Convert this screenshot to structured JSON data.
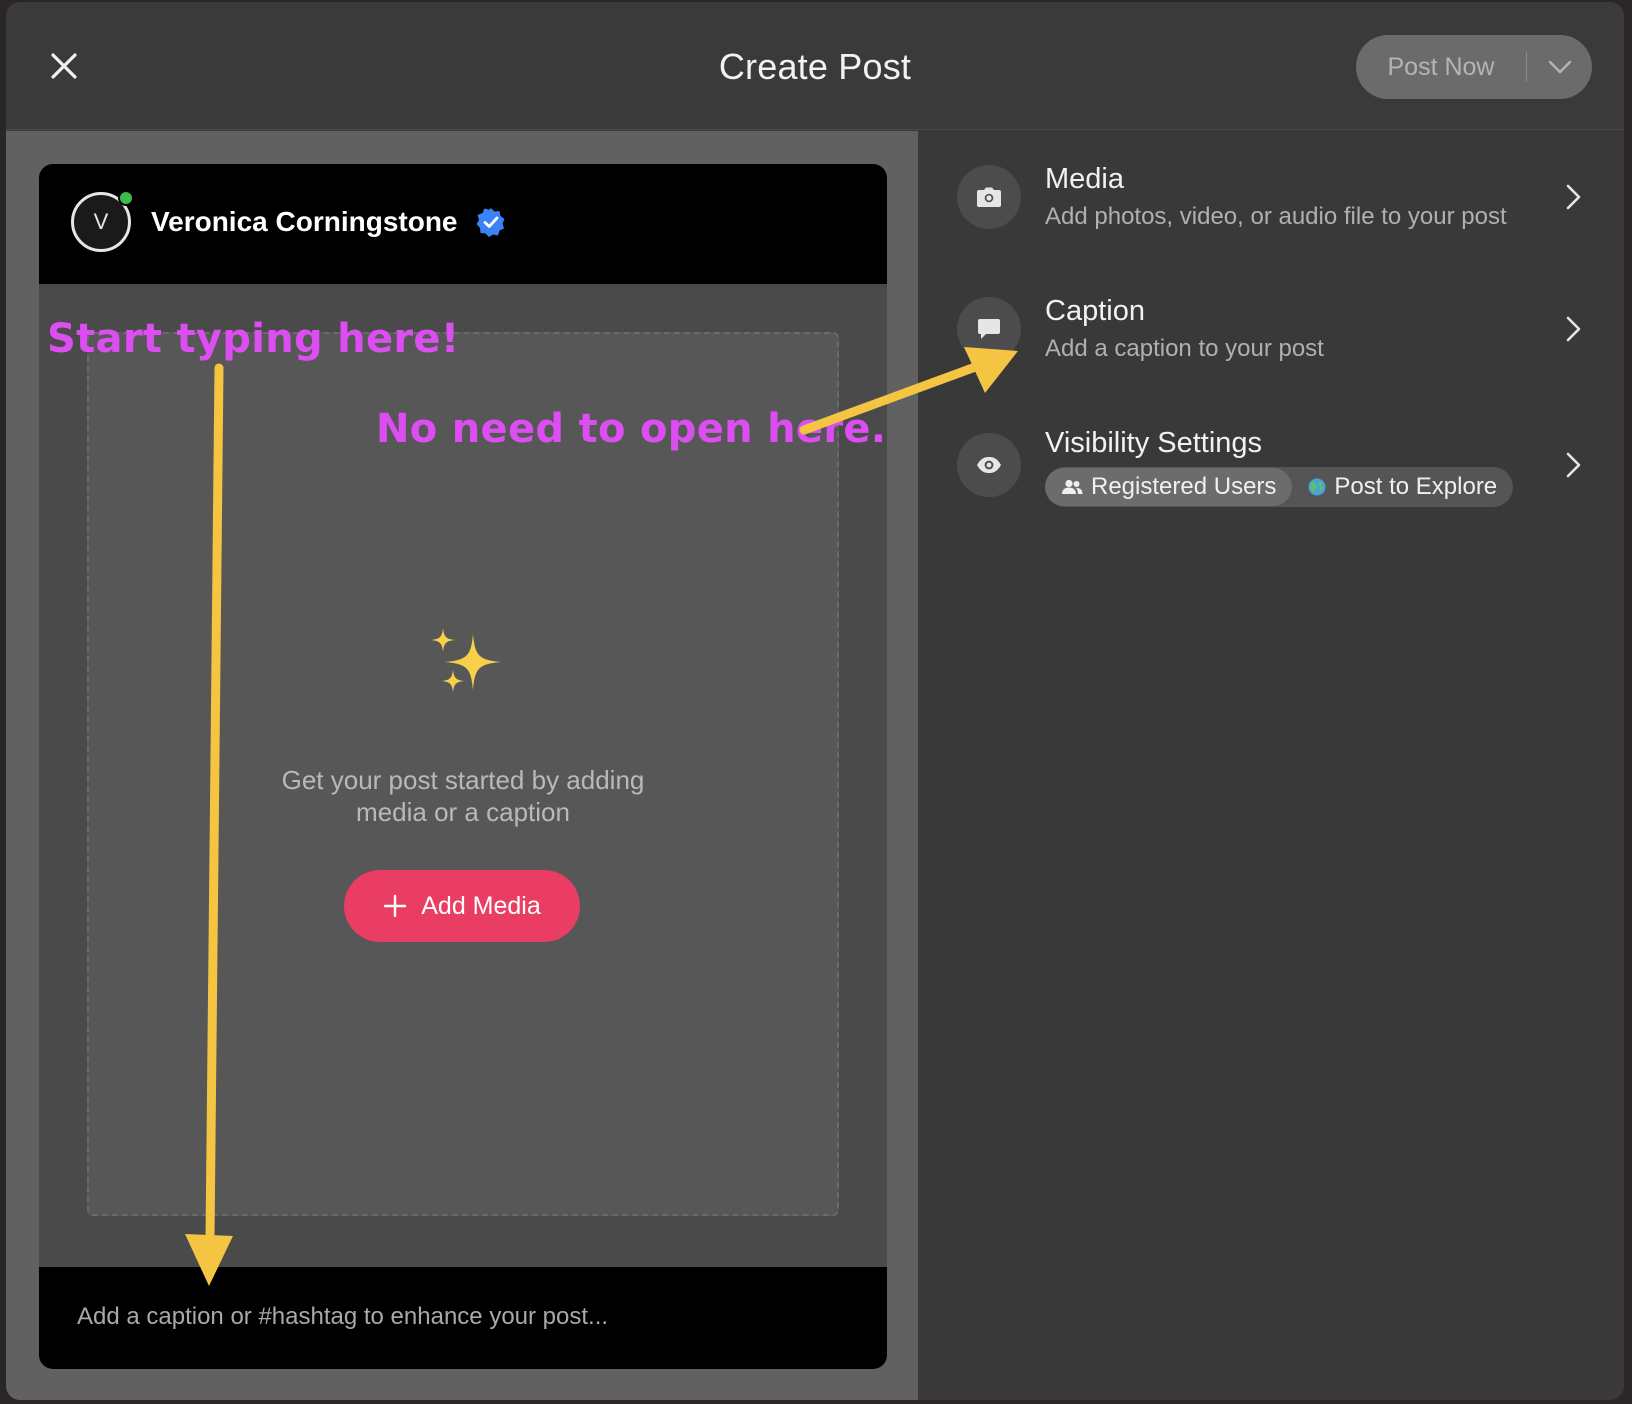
{
  "header": {
    "title": "Create Post",
    "post_button_label": "Post Now"
  },
  "profile": {
    "avatar_initial": "V",
    "name": "Veronica Corningstone"
  },
  "dropzone": {
    "prompt_line1": "Get your post started by adding",
    "prompt_line2": "media or a caption",
    "add_media_label": "Add Media"
  },
  "caption_bar": {
    "placeholder": "Add a caption or #hashtag to enhance your post..."
  },
  "settings": {
    "media": {
      "title": "Media",
      "subtitle": "Add photos, video, or audio file to your post"
    },
    "caption": {
      "title": "Caption",
      "subtitle": "Add a caption to your post"
    },
    "visibility": {
      "title": "Visibility Settings",
      "options": [
        "Registered Users",
        "Post to Explore"
      ],
      "selected": "Registered Users"
    }
  },
  "annotations": {
    "start_typing": "Start typing here!",
    "no_need": "No need to open here."
  },
  "colors": {
    "accent": "#ea3d63",
    "annotation_text": "#dd4ef2",
    "annotation_arrow": "#f4c542",
    "verified": "#3b82f6",
    "online": "#3dbb4c"
  }
}
